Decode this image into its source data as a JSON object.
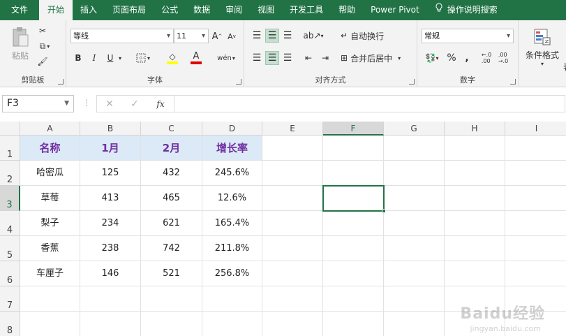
{
  "tabs": [
    {
      "label": "文件",
      "active": false
    },
    {
      "label": "开始",
      "active": true
    },
    {
      "label": "插入",
      "active": false
    },
    {
      "label": "页面布局",
      "active": false
    },
    {
      "label": "公式",
      "active": false
    },
    {
      "label": "数据",
      "active": false
    },
    {
      "label": "审阅",
      "active": false
    },
    {
      "label": "视图",
      "active": false
    },
    {
      "label": "开发工具",
      "active": false
    },
    {
      "label": "帮助",
      "active": false
    },
    {
      "label": "Power Pivot",
      "active": false
    },
    {
      "label": "操作说明搜索",
      "active": false
    }
  ],
  "ribbon": {
    "clipboard": {
      "label": "剪贴板",
      "paste_label": "粘贴"
    },
    "font": {
      "label": "字体",
      "font_name": "等线",
      "font_size": "11",
      "bold": "B",
      "italic": "I",
      "underline": "U",
      "grow": "A",
      "shrink": "A"
    },
    "alignment": {
      "label": "对齐方式",
      "wrap_text": "自动换行",
      "merge_center": "合并后居中"
    },
    "number": {
      "label": "数字",
      "format": "常规",
      "percent": "%",
      "comma": ","
    },
    "styles": {
      "cond_format": "条件格式",
      "cut_off": "表"
    }
  },
  "formula_bar": {
    "name_box": "F3",
    "fx": "fx",
    "value": ""
  },
  "grid": {
    "columns": [
      "A",
      "B",
      "C",
      "D",
      "E",
      "F",
      "G",
      "H",
      "I"
    ],
    "selected_col": "F",
    "selected_row": "3",
    "rows": [
      "1",
      "2",
      "3",
      "4",
      "5",
      "6",
      "7",
      "8"
    ],
    "header_row": [
      "名称",
      "1月",
      "2月",
      "增长率"
    ],
    "data": [
      [
        "哈密瓜",
        "125",
        "432",
        "245.6%"
      ],
      [
        "草莓",
        "413",
        "465",
        "12.6%"
      ],
      [
        "梨子",
        "234",
        "621",
        "165.4%"
      ],
      [
        "香蕉",
        "238",
        "742",
        "211.8%"
      ],
      [
        "车厘子",
        "146",
        "521",
        "256.8%"
      ]
    ]
  },
  "watermark": {
    "main": "Baidu经验",
    "sub": "jingyan.baidu.com"
  },
  "colors": {
    "excel_green": "#217346",
    "header_fill": "#dce9f6",
    "header_text": "#7030a0"
  }
}
